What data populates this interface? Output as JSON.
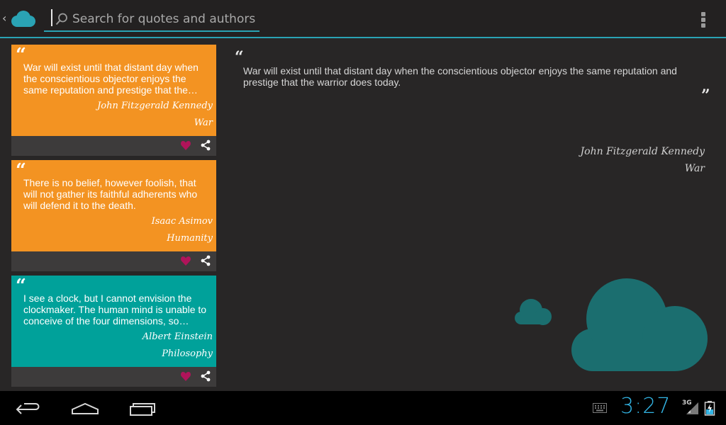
{
  "search": {
    "placeholder": "Search for quotes and authors",
    "value": ""
  },
  "colors": {
    "accent": "#2aa3b4",
    "orange": "#f39322",
    "teal": "#00a19a",
    "heart": "#b0145a",
    "cloud": "#1b6e6f"
  },
  "quotes": [
    {
      "text": "War will exist until that distant day when the conscientious objector enjoys the same reputation and prestige that the…",
      "author": "John Fitzgerald Kennedy",
      "category": "War",
      "color": "#f39322"
    },
    {
      "text": "There is no belief, however foolish, that will not gather its faithful adherents who will defend it to the death.",
      "author": "Isaac Asimov",
      "category": "Humanity",
      "color": "#f39322"
    },
    {
      "text": "I see a clock, but I cannot envision the clockmaker. The human mind is unable to conceive of the four dimensions, so…",
      "author": "Albert Einstein",
      "category": "Philosophy",
      "color": "#00a19a"
    }
  ],
  "detail": {
    "text": "War will exist until that distant day when the conscientious objector enjoys the same reputation and prestige that the warrior does today.",
    "author": "John Fitzgerald Kennedy",
    "category": "War"
  },
  "status": {
    "time": "3:27",
    "network": "3G"
  },
  "icons": {
    "up": "chevron-left-icon",
    "logo": "cloud-logo-icon",
    "search": "search-icon",
    "menu": "overflow-menu-icon",
    "favorite": "heart-icon",
    "share": "share-icon",
    "back": "back-icon",
    "home": "home-icon",
    "recent": "recent-apps-icon",
    "keyboard": "keyboard-icon",
    "signal": "signal-icon",
    "battery": "battery-icon"
  }
}
